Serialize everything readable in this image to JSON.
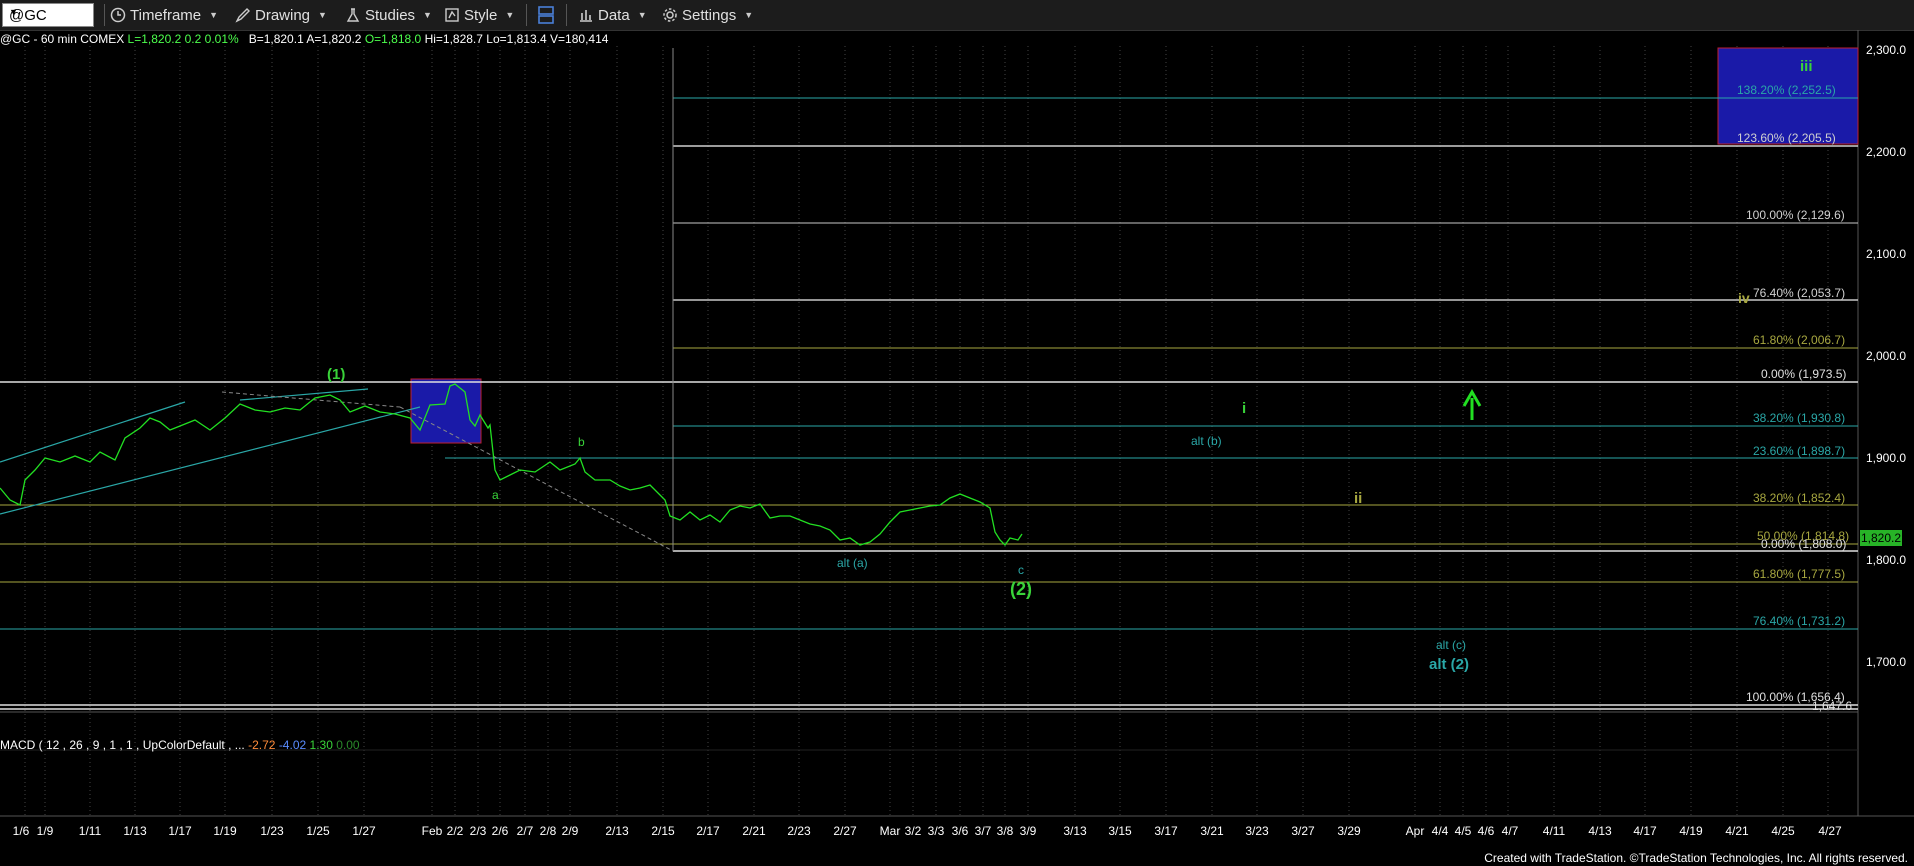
{
  "toolbar": {
    "symbol": "@GC",
    "timeframe": "Timeframe",
    "drawing": "Drawing",
    "studies": "Studies",
    "style": "Style",
    "data": "Data",
    "settings": "Settings"
  },
  "info": {
    "prefix": "@GC - 60 min  COMEX",
    "last": "L=1,820.2",
    "change": "0.2",
    "pct": "0.01%",
    "bid": "B=1,820.1",
    "ask": "A=1,820.2",
    "open": "O=1,818.0",
    "high": "Hi=1,828.7",
    "low": "Lo=1,813.4",
    "volume": "V=180,414"
  },
  "macd": {
    "label": "MACD ( 12 , 26 , 9 , 1 , 1 , UpColorDefault , ...",
    "v1": "-2.72",
    "v2": "-4.02",
    "v3": "1.30",
    "v4": "0.00"
  },
  "price_axis": [
    "2,300.0",
    "2,200.0",
    "2,100.0",
    "2,000.0",
    "1,900.0",
    "1,800.0",
    "1,700.0"
  ],
  "current_price": "1,820.2",
  "x_axis": [
    "1/6",
    "1/9",
    "1/11",
    "1/13",
    "1/17",
    "1/19",
    "1/23",
    "1/25",
    "1/27",
    "Feb",
    "2/2",
    "2/3",
    "2/6",
    "2/7",
    "2/8",
    "2/9",
    "2/13",
    "2/15",
    "2/17",
    "2/21",
    "2/23",
    "2/27",
    "Mar",
    "3/2",
    "3/3",
    "3/6",
    "3/7",
    "3/8",
    "3/9",
    "3/13",
    "3/15",
    "3/17",
    "3/21",
    "3/23",
    "3/27",
    "3/29",
    "Apr",
    "4/4",
    "4/5",
    "4/6",
    "4/7",
    "4/11",
    "4/13",
    "4/17",
    "4/19",
    "4/21",
    "4/25",
    "4/27"
  ],
  "fib_labels": [
    "138.20% (2,252.5)",
    "123.60% (2,205.5)",
    "100.00% (2,129.6)",
    "76.40% (2,053.7)",
    "61.80% (2,006.7)",
    "0.00% (1,973.5)",
    "38.20% (1,930.8)",
    "23.60% (1,898.7)",
    "38.20% (1,852.4)",
    "50.00% (1,814.8)",
    "0.00% (1,808.0)",
    "61.80% (1,777.5)",
    "76.40% (1,731.2)",
    "100.00% (1,656.4)",
    "1,647.6"
  ],
  "wave_labels": {
    "w1": "(1)",
    "a": "a",
    "b": "b",
    "c": "c",
    "w2": "(2)",
    "alt_a": "alt (a)",
    "alt_b": "alt (b)",
    "alt_c": "alt (c)",
    "alt_2": "alt (2)",
    "i": "i",
    "ii": "ii",
    "iii": "iii",
    "iv": "iv"
  },
  "colors": {
    "price": "#22e022",
    "teal": "#2aa7a7",
    "olive": "#a8a840",
    "green_label": "#39d339",
    "blue_box": "#1a1aa8"
  },
  "footer": "Created with TradeStation. ©TradeStation Technologies, Inc. All rights reserved."
}
